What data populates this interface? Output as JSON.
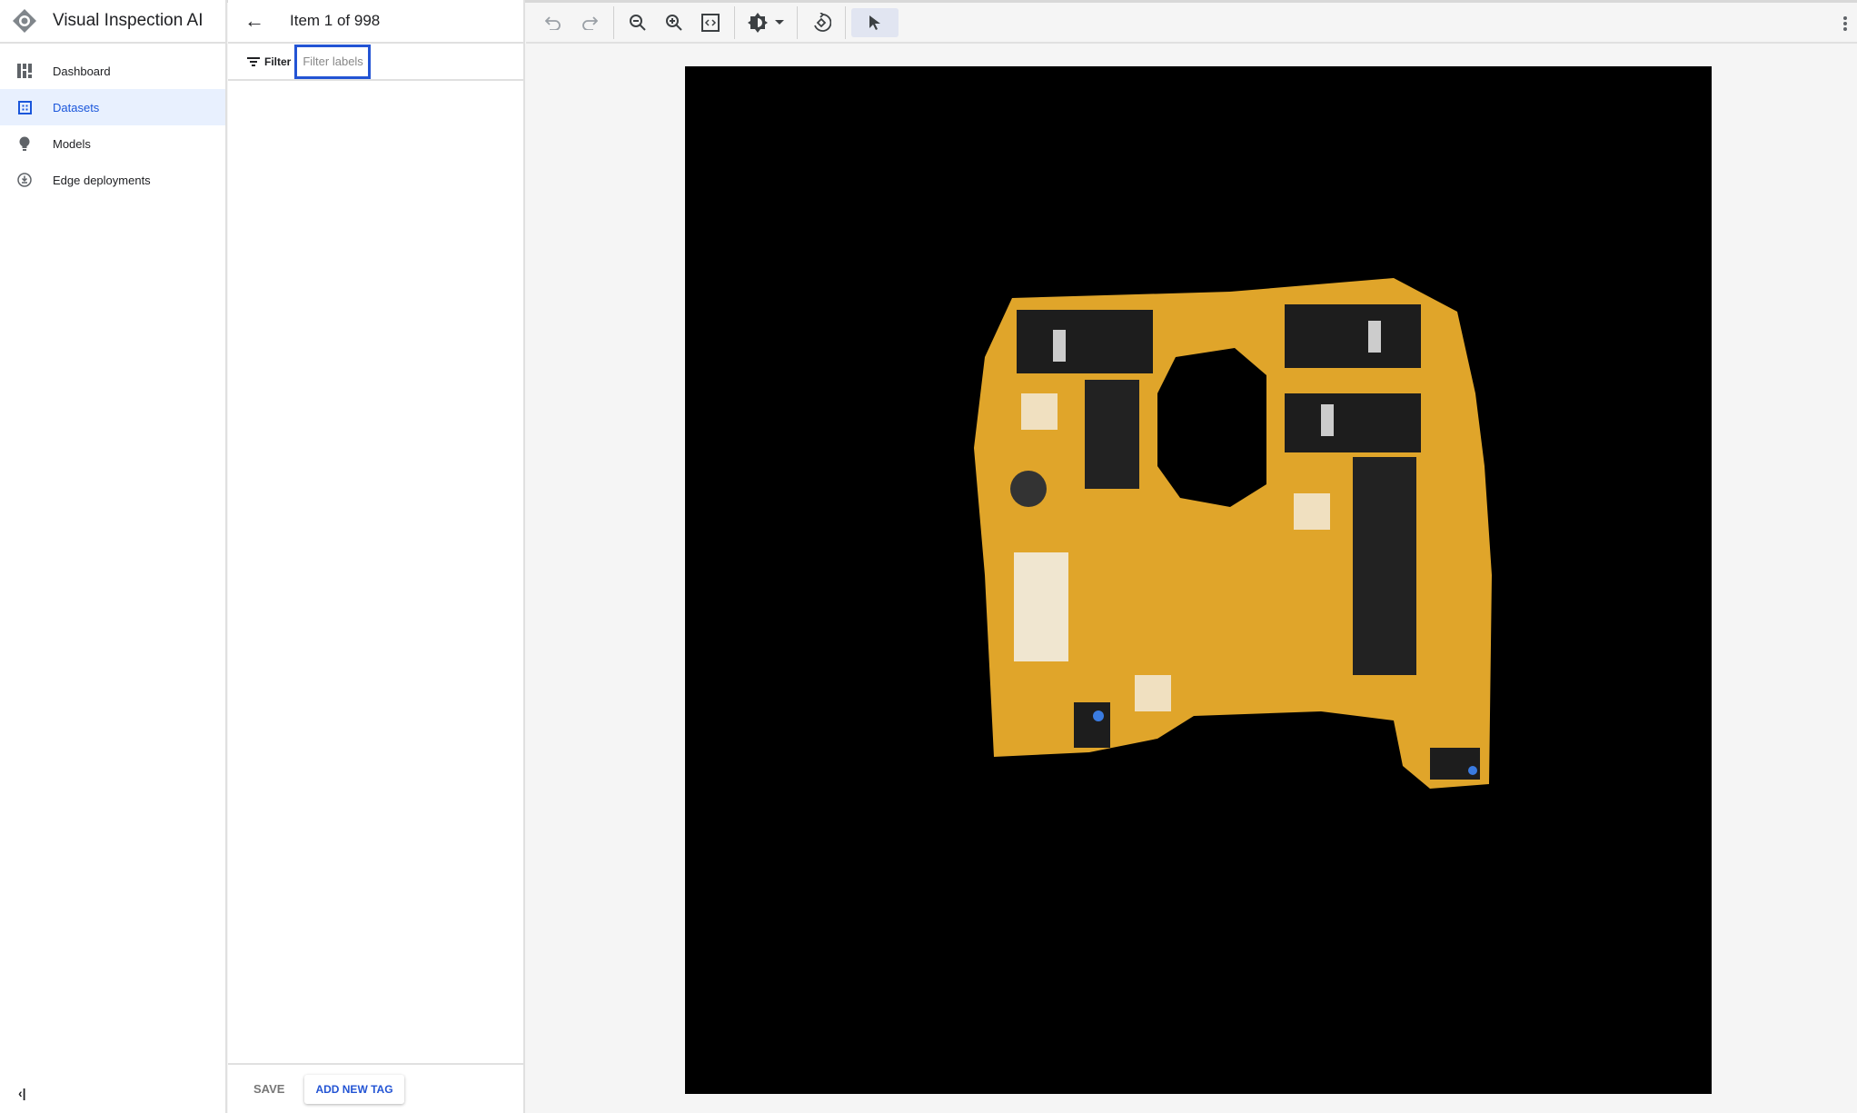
{
  "app": {
    "title": "Visual Inspection AI",
    "logo_icon": "visual-inspection-logo"
  },
  "sidebar": {
    "items": [
      {
        "label": "Dashboard",
        "icon": "dashboard-icon",
        "active": false
      },
      {
        "label": "Datasets",
        "icon": "datasets-icon",
        "active": true
      },
      {
        "label": "Models",
        "icon": "lightbulb-icon",
        "active": false
      },
      {
        "label": "Edge deployments",
        "icon": "edge-deploy-icon",
        "active": false
      }
    ],
    "collapse_icon": "collapse-sidebar-icon"
  },
  "panel": {
    "title": "Item 1 of 998",
    "filter_label": "Filter",
    "filter_placeholder": "Filter labels",
    "save_label": "SAVE",
    "add_tag_label": "ADD NEW TAG"
  },
  "toolbar": {
    "tools": [
      "undo",
      "redo",
      "zoom-out",
      "zoom-in",
      "fit-to-screen",
      "brightness",
      "reset-rotation",
      "select"
    ],
    "selected": "select"
  },
  "colors": {
    "accent": "#2354d4",
    "active_bg": "#e8f0fe",
    "board": "#e0a52a"
  }
}
